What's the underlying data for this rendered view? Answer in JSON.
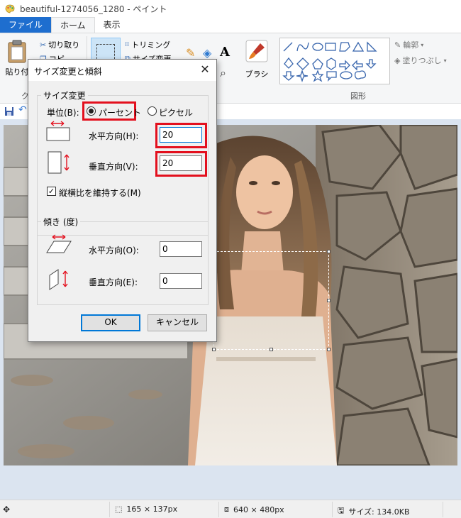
{
  "window": {
    "title": "beautiful-1274056_1280 - ペイント"
  },
  "tabs": [
    "ファイル",
    "ホーム",
    "表示"
  ],
  "ribbon": {
    "paste_label": "貼り付",
    "cut_label": "切り取り",
    "copy_label": "コピ",
    "crop_label": "トリミング",
    "resize_label": "サイズ変更",
    "clipboard_group": "ク",
    "brushes_label": "ブラシ",
    "outline_label": "輪郭",
    "fill_label": "塗りつぶし",
    "shapes_group": "図形"
  },
  "dialog": {
    "title": "サイズ変更と傾斜",
    "resize_group": "サイズ変更",
    "unit_label": "単位(B):",
    "percent_label": "パーセント",
    "pixels_label": "ピクセル",
    "unit_selected": "パーセント",
    "horizontal_label": "水平方向(H):",
    "horizontal_value": "20",
    "vertical_label": "垂直方向(V):",
    "vertical_value": "20",
    "keep_ratio_label": "縦横比を維持する(M)",
    "keep_ratio_checked": true,
    "skew_group": "傾き (度)",
    "skew_horizontal_label": "水平方向(O):",
    "skew_horizontal_value": "0",
    "skew_vertical_label": "垂直方向(E):",
    "skew_vertical_value": "0",
    "ok_label": "OK",
    "cancel_label": "キャンセル"
  },
  "status": {
    "selection_size": "165 × 137px",
    "image_size": "640 × 480px",
    "file_size": "サイズ: 134.0KB"
  },
  "colors": {
    "accent": "#1e6ecf",
    "highlight": "#e3101e",
    "canvas_bg": "#dbe4f0"
  }
}
